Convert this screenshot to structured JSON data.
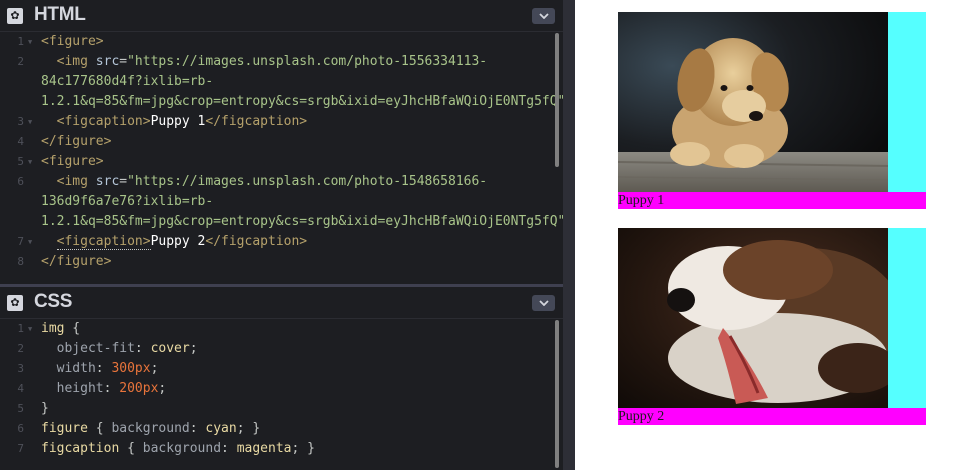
{
  "html_panel": {
    "title": "HTML",
    "lines": [
      {
        "n": "1",
        "fold": true,
        "parts": [
          [
            "t-tag",
            "<figure>"
          ]
        ]
      },
      {
        "n": "2",
        "fold": false,
        "parts": [
          [
            "t-tag",
            "  <img "
          ],
          [
            "t-attr",
            "src"
          ],
          [
            "t-punc",
            "="
          ],
          [
            "t-str",
            "\"https://images.unsplash.com/photo-1556334113-"
          ]
        ]
      },
      {
        "n": "",
        "fold": false,
        "parts": [
          [
            "t-str",
            "84c177680d4f?ixlib=rb-"
          ]
        ]
      },
      {
        "n": "",
        "fold": false,
        "parts": [
          [
            "t-str",
            "1.2.1&q=85&fm=jpg&crop=entropy&cs=srgb&ixid=eyJhcHBfaWQiOjE0NTg5fQ\""
          ],
          [
            "t-tag",
            ">"
          ]
        ]
      },
      {
        "n": "3",
        "fold": true,
        "parts": [
          [
            "t-tag",
            "  <figcaption>"
          ],
          [
            "t-txt",
            "Puppy 1"
          ],
          [
            "t-tag",
            "</figcaption>"
          ]
        ]
      },
      {
        "n": "4",
        "fold": false,
        "parts": [
          [
            "t-tag",
            "</figure>"
          ]
        ]
      },
      {
        "n": "5",
        "fold": true,
        "parts": [
          [
            "t-tag",
            "<figure>"
          ]
        ]
      },
      {
        "n": "6",
        "fold": false,
        "parts": [
          [
            "t-tag",
            "  <img "
          ],
          [
            "t-attr",
            "src"
          ],
          [
            "t-punc",
            "="
          ],
          [
            "t-str",
            "\"https://images.unsplash.com/photo-1548658166-"
          ]
        ]
      },
      {
        "n": "",
        "fold": false,
        "parts": [
          [
            "t-str",
            "136d9f6a7e76?ixlib=rb-"
          ]
        ]
      },
      {
        "n": "",
        "fold": false,
        "parts": [
          [
            "t-str",
            "1.2.1&q=85&fm=jpg&crop=entropy&cs=srgb&ixid=eyJhcHBfaWQiOjE0NTg5fQ\""
          ],
          [
            "t-tag",
            ">"
          ]
        ]
      },
      {
        "n": "7",
        "fold": true,
        "parts": [
          [
            "t-tag",
            "  "
          ],
          [
            "t-tag hl-underline",
            "<figcaption>"
          ],
          [
            "t-txt",
            "Puppy 2"
          ],
          [
            "t-tag",
            "</figcaption>"
          ]
        ]
      },
      {
        "n": "8",
        "fold": false,
        "parts": [
          [
            "t-tag",
            "</figure>"
          ]
        ]
      }
    ]
  },
  "css_panel": {
    "title": "CSS",
    "lines": [
      {
        "n": "1",
        "fold": true,
        "parts": [
          [
            "t-sel",
            "img"
          ],
          [
            "t-punc",
            " {"
          ]
        ]
      },
      {
        "n": "2",
        "fold": false,
        "parts": [
          [
            "t-prop",
            "  object-fit"
          ],
          [
            "t-punc",
            ": "
          ],
          [
            "t-val",
            "cover"
          ],
          [
            "t-punc",
            ";"
          ]
        ]
      },
      {
        "n": "3",
        "fold": false,
        "parts": [
          [
            "t-prop",
            "  width"
          ],
          [
            "t-punc",
            ": "
          ],
          [
            "t-num",
            "300px"
          ],
          [
            "t-punc",
            ";"
          ]
        ]
      },
      {
        "n": "4",
        "fold": false,
        "parts": [
          [
            "t-prop",
            "  height"
          ],
          [
            "t-punc",
            ": "
          ],
          [
            "t-num",
            "200px"
          ],
          [
            "t-punc",
            ";"
          ]
        ]
      },
      {
        "n": "5",
        "fold": false,
        "parts": [
          [
            "t-punc",
            "}"
          ]
        ]
      },
      {
        "n": "6",
        "fold": false,
        "parts": [
          [
            "t-sel",
            "figure"
          ],
          [
            "t-punc",
            " { "
          ],
          [
            "t-prop",
            "background"
          ],
          [
            "t-punc",
            ": "
          ],
          [
            "t-val",
            "cyan"
          ],
          [
            "t-punc",
            "; }"
          ]
        ]
      },
      {
        "n": "7",
        "fold": false,
        "parts": [
          [
            "t-sel",
            "figcaption"
          ],
          [
            "t-punc",
            " { "
          ],
          [
            "t-prop",
            "background"
          ],
          [
            "t-punc",
            ": "
          ],
          [
            "t-val",
            "magenta"
          ],
          [
            "t-punc",
            "; }"
          ]
        ]
      }
    ]
  },
  "preview": {
    "figures": [
      {
        "caption": "Puppy 1",
        "image": "puppy-photo-1"
      },
      {
        "caption": "Puppy 2",
        "image": "puppy-photo-2"
      }
    ]
  },
  "icons": {
    "settings": "gear-icon",
    "collapse": "chevron-down-icon"
  },
  "colors": {
    "figure_bg": "#55ffff",
    "figcaption_bg": "#ff00ff",
    "editor_bg": "#1d1e22"
  }
}
